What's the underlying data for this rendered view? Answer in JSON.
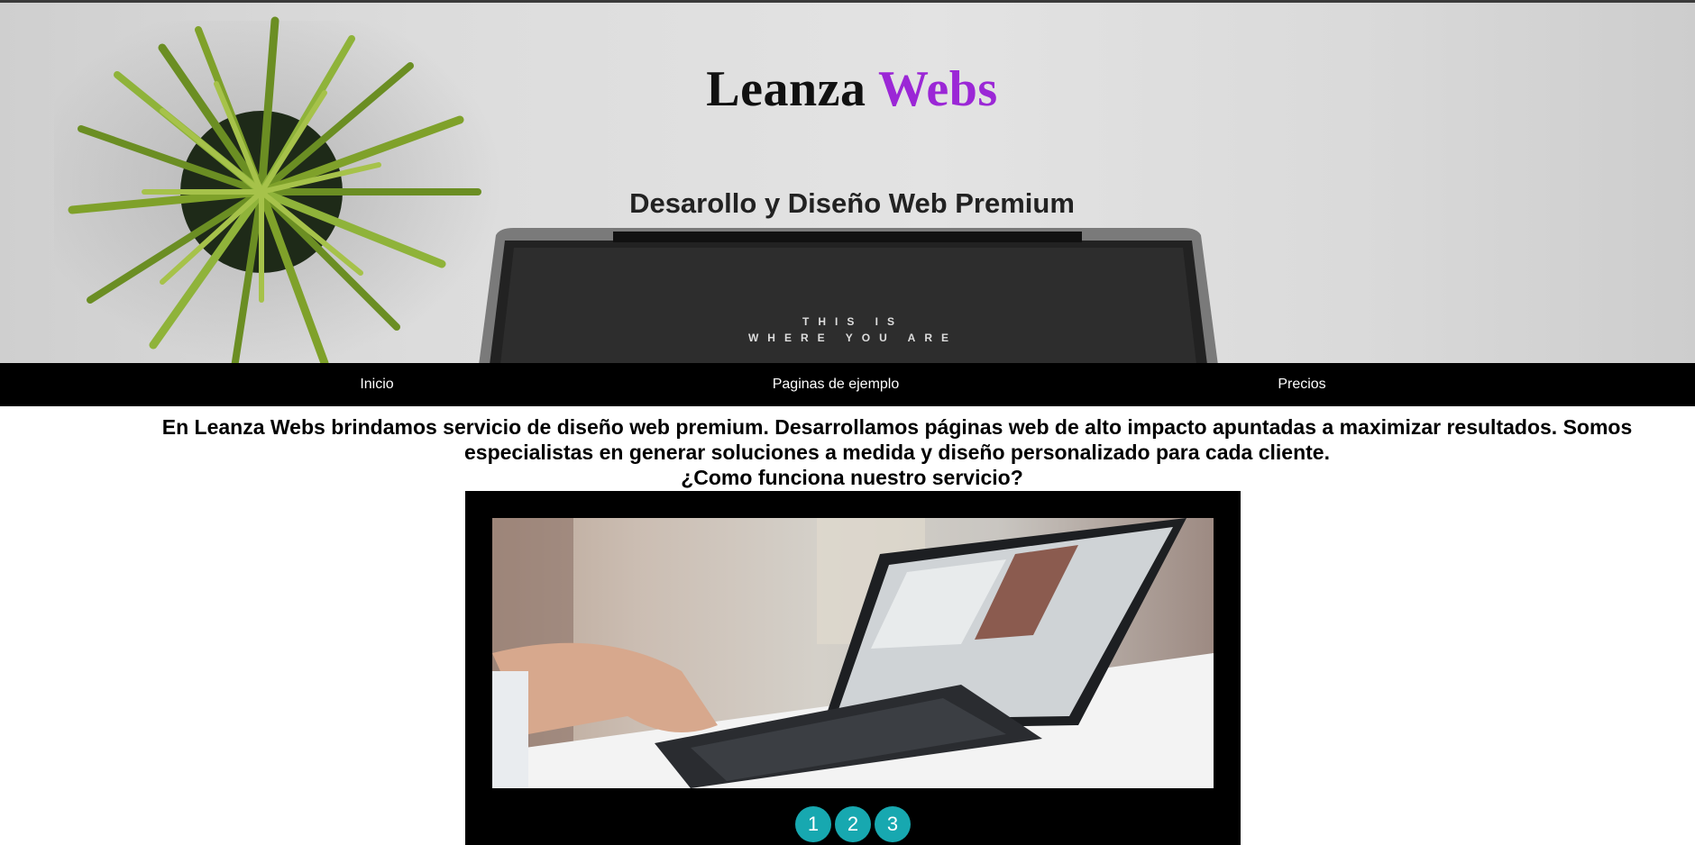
{
  "brand": {
    "name_part1": "Leanza",
    "name_part2": "Webs",
    "accent_color": "#9b27d6"
  },
  "hero": {
    "tagline": "Desarollo y Diseño Web Premium",
    "screen_text_line1": "THIS IS",
    "screen_text_line2": "WHERE YOU ARE"
  },
  "nav": {
    "items": [
      {
        "label": "Inicio"
      },
      {
        "label": "Paginas de ejemplo"
      },
      {
        "label": "Precios"
      }
    ]
  },
  "intro": {
    "text": "En Leanza Webs brindamos servicio de diseño web premium. Desarrollamos páginas web de alto impacto apuntadas a maximizar resultados. Somos especialistas en generar soluciones a medida y diseño personalizado para cada cliente.",
    "question": "¿Como funciona nuestro servicio?"
  },
  "slider": {
    "dots": [
      {
        "label": "1"
      },
      {
        "label": "2"
      },
      {
        "label": "3"
      }
    ],
    "dot_color": "#17a8b0"
  }
}
